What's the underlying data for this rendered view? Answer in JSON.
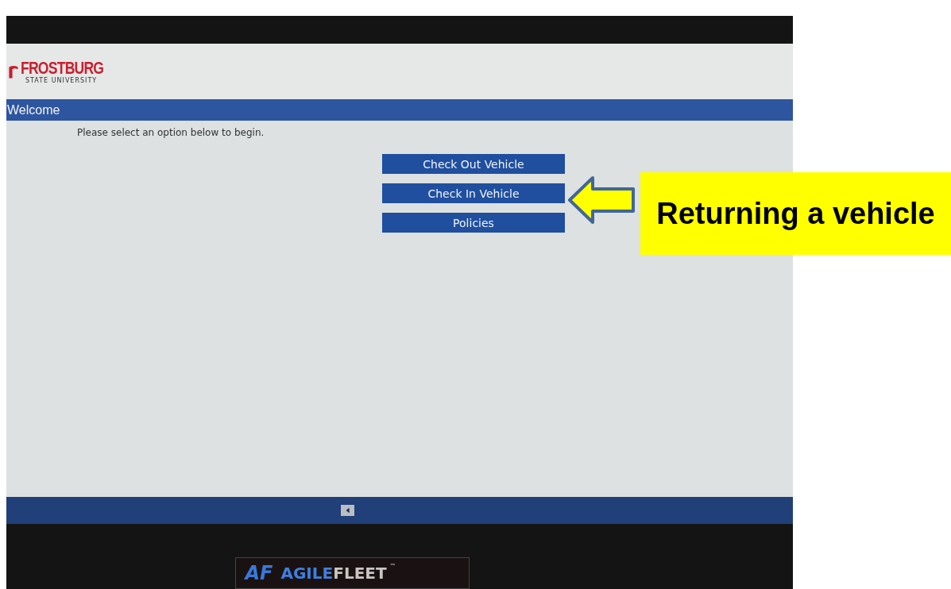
{
  "logo": {
    "name": "FROSTBURG",
    "subtitle": "STATE UNIVERSITY"
  },
  "header": {
    "title": "Welcome"
  },
  "prompt": "Please select an option below to begin.",
  "buttons": [
    "Check Out Vehicle",
    "Check In Vehicle",
    "Policies"
  ],
  "bezel_logo": {
    "mark": "AF",
    "brand_first": "AGILE",
    "brand_second": "FLEET",
    "trademark": "™"
  },
  "callout": {
    "text": "Returning a vehicle"
  }
}
